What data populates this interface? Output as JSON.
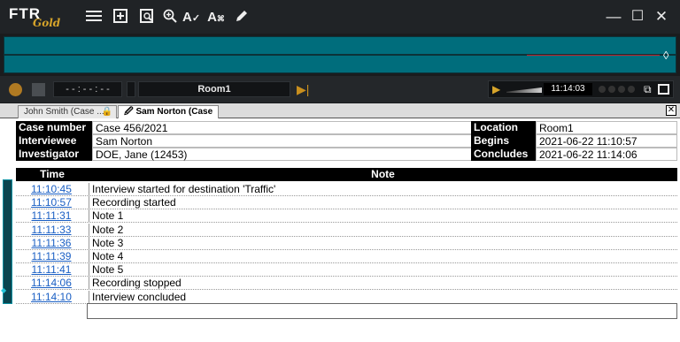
{
  "app": {
    "logo_text": "FTR",
    "logo_sub": "Gold"
  },
  "toolbar": {
    "icons": [
      "menu-icon",
      "add-note-icon",
      "search-doc-icon",
      "zoom-icon",
      "spellcheck-icon",
      "text-replace-icon",
      "pen-icon"
    ]
  },
  "window_controls": {
    "minimize": "—",
    "maximize": "☐",
    "close": "✕"
  },
  "player": {
    "time_display": "- - : - - : - -",
    "room": "Room1",
    "clock": "11:14:03"
  },
  "tabs": [
    {
      "label": "John Smith (Case ..."
    },
    {
      "label": "Sam Norton (Case ..."
    }
  ],
  "case_info": {
    "case_number_label": "Case number",
    "case_number": "Case 456/2021",
    "interviewee_label": "Interviewee",
    "interviewee": "Sam Norton",
    "investigator_label": "Investigator",
    "investigator": "DOE, Jane (12453)",
    "location_label": "Location",
    "location": "Room1",
    "begins_label": "Begins",
    "begins": "2021-06-22 11:10:57",
    "concludes_label": "Concludes",
    "concludes": "2021-06-22 11:14:06"
  },
  "notes_table": {
    "time_header": "Time",
    "note_header": "Note",
    "rows": [
      {
        "time": "11:10:45",
        "note": "Interview started for destination 'Traffic'"
      },
      {
        "time": "11:10:57",
        "note": "Recording started"
      },
      {
        "time": "11:11:31",
        "note": "Note 1"
      },
      {
        "time": "11:11:33",
        "note": "Note 2"
      },
      {
        "time": "11:11:36",
        "note": "Note 3"
      },
      {
        "time": "11:11:39",
        "note": "Note 4"
      },
      {
        "time": "11:11:41",
        "note": "Note 5"
      },
      {
        "time": "11:14:06",
        "note": "Recording stopped"
      },
      {
        "time": "11:14:10",
        "note": "Interview concluded"
      }
    ]
  },
  "colors": {
    "waveform": "#006d7c",
    "accent_gold": "#d6a42a",
    "link": "#1a5fc4"
  }
}
